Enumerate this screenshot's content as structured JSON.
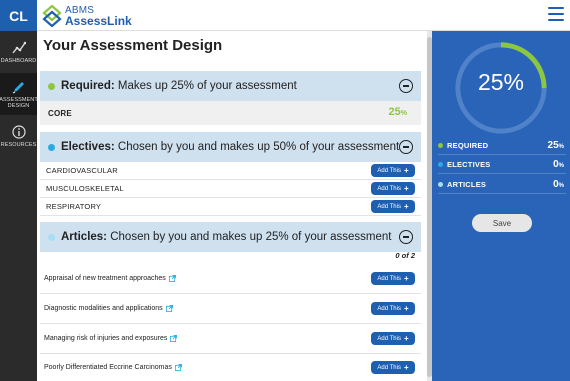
{
  "header": {
    "logo": "CL",
    "brand_line1": "ABMS",
    "brand_line2": "AssessLink"
  },
  "sidebar": {
    "items": [
      {
        "label": "DASHBOARD",
        "icon": "chart-line-icon"
      },
      {
        "label": "ASSESSMENT DESIGN",
        "icon": "pencil-icon",
        "active": true
      },
      {
        "label": "RESOURCES",
        "icon": "info-icon"
      }
    ]
  },
  "main": {
    "title": "Your Assessment Design",
    "required": {
      "bold": "Required:",
      "rest": " Makes up 25% of your assessment",
      "dot_color": "#8dc63f"
    },
    "core": {
      "label": "CORE",
      "value": "25",
      "unit": "%"
    },
    "electives": {
      "bold": "Electives:",
      "rest": " Chosen by you and makes up 50% of your assessment",
      "dot_color": "#29abe2",
      "items": [
        "CARDIOVASCULAR",
        "MUSCULOSKELETAL",
        "RESPIRATORY"
      ]
    },
    "articles": {
      "bold": "Articles:",
      "rest": " Chosen by you and makes up 25% of your assessment",
      "dot_color": "#a6dff5",
      "count": "0 of 2",
      "items": [
        "Appraisal of new treatment approaches",
        "Diagnostic modalities and applications",
        "Managing risk of injuries and exposures",
        "Poorly Differentiated Eccrine Carcinomas"
      ]
    },
    "add_label": "Add This",
    "add_plus": "+"
  },
  "panel": {
    "gauge_value": "25%",
    "progress_fraction": 0.25,
    "accent": "#8dc63f",
    "stats": [
      {
        "label": "REQUIRED",
        "value": "25",
        "unit": "%",
        "color": "#8dc63f"
      },
      {
        "label": "ELECTIVES",
        "value": "0",
        "unit": "%",
        "color": "#29abe2"
      },
      {
        "label": "ARTICLES",
        "value": "0",
        "unit": "%",
        "color": "#a6dff5"
      }
    ],
    "save_label": "Save"
  }
}
